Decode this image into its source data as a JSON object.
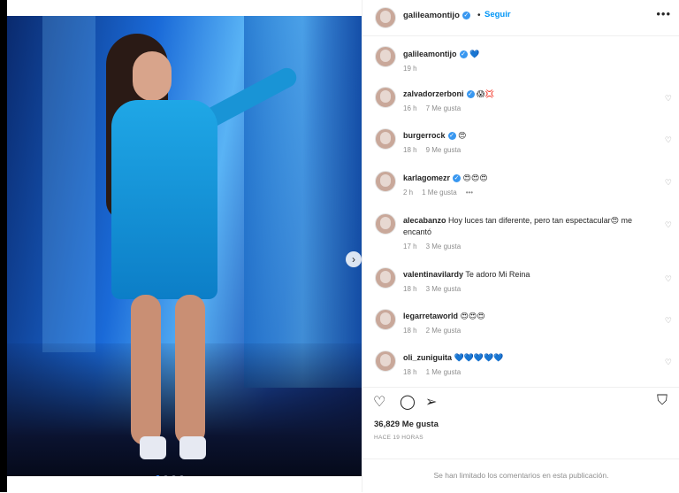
{
  "post": {
    "author": "galileamontijo",
    "follow_label": "Seguir",
    "dot": "•",
    "more_icon": "more-options-icon",
    "caption_emoji": "💙",
    "caption_time": "19 h",
    "likes": "36,829 Me gusta",
    "posted_ago": "HACE 19 HORAS",
    "comments_limited": "Se han limitado los comentarios en esta publicación."
  },
  "comments": [
    {
      "user": "zalvadorzerboni",
      "text": "😱💢",
      "time": "16 h",
      "likes": "7 Me gusta",
      "verified": true
    },
    {
      "user": "burgerrock",
      "text": "😍",
      "time": "18 h",
      "likes": "9 Me gusta",
      "verified": true
    },
    {
      "user": "karlagomezr",
      "text": "😍😍😍",
      "time": "2 h",
      "likes": "1 Me gusta",
      "verified": true,
      "extra": "•••"
    },
    {
      "user": "alecabanzo",
      "text": "Hoy luces tan diferente, pero tan espectacular😍 me encantó",
      "time": "17 h",
      "likes": "3 Me gusta",
      "verified": false
    },
    {
      "user": "valentinavilardy",
      "text": "Te adoro Mi Reina",
      "time": "18 h",
      "likes": "3 Me gusta",
      "verified": false
    },
    {
      "user": "legarretaworld",
      "text": "😍😍😍",
      "time": "18 h",
      "likes": "2 Me gusta",
      "verified": false
    },
    {
      "user": "oli_zuniguita",
      "text": "💙💙💙💙💙",
      "time": "18 h",
      "likes": "1 Me gusta",
      "verified": false
    }
  ],
  "icons": {
    "like": "heart-icon",
    "comment": "comment-icon",
    "share": "share-icon",
    "save": "bookmark-icon",
    "next": "chevron-right-icon"
  },
  "colors": {
    "accent": "#0095f6",
    "verified": "#3897f0",
    "muted": "#8e8e8e"
  }
}
